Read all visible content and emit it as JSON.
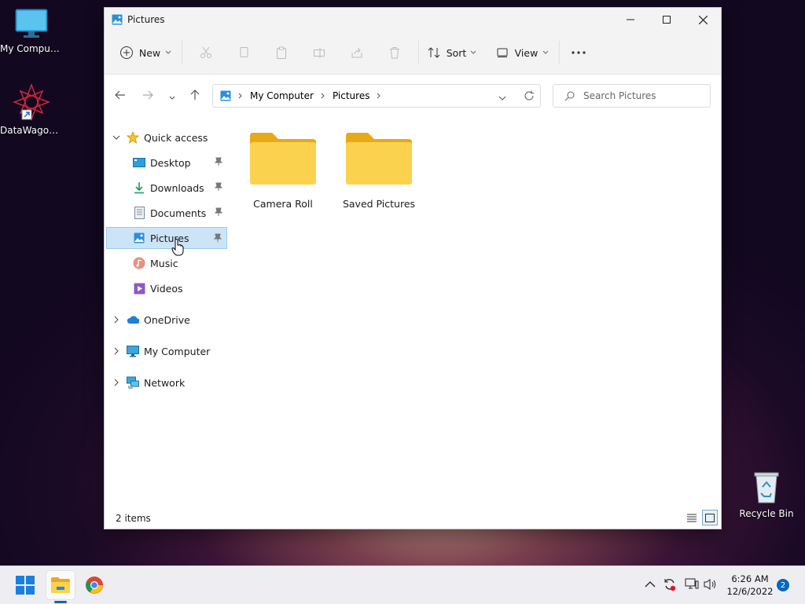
{
  "desktop": {
    "icons": [
      {
        "label": "My Computer"
      },
      {
        "label": "DataWagon..."
      },
      {
        "label": "Recycle Bin"
      }
    ]
  },
  "window": {
    "title": "Pictures",
    "toolbar": {
      "new_label": "New",
      "sort_label": "Sort",
      "view_label": "View"
    },
    "address": {
      "crumbs": [
        "My Computer",
        "Pictures"
      ]
    },
    "search": {
      "placeholder": "Search Pictures"
    },
    "sidebar": {
      "quick_access": "Quick access",
      "items": [
        {
          "label": "Desktop"
        },
        {
          "label": "Downloads"
        },
        {
          "label": "Documents"
        },
        {
          "label": "Pictures"
        },
        {
          "label": "Music"
        },
        {
          "label": "Videos"
        }
      ],
      "roots": [
        {
          "label": "OneDrive"
        },
        {
          "label": "My Computer"
        },
        {
          "label": "Network"
        }
      ]
    },
    "folders": [
      {
        "name": "Camera Roll"
      },
      {
        "name": "Saved Pictures"
      }
    ],
    "status": {
      "items_count": "2 items"
    }
  },
  "taskbar": {
    "time": "6:26 AM",
    "date": "12/6/2022",
    "notification_count": "2"
  },
  "colors": {
    "accent": "#0067c0",
    "selection": "#cce4f7",
    "folder": "#f8c94a"
  }
}
